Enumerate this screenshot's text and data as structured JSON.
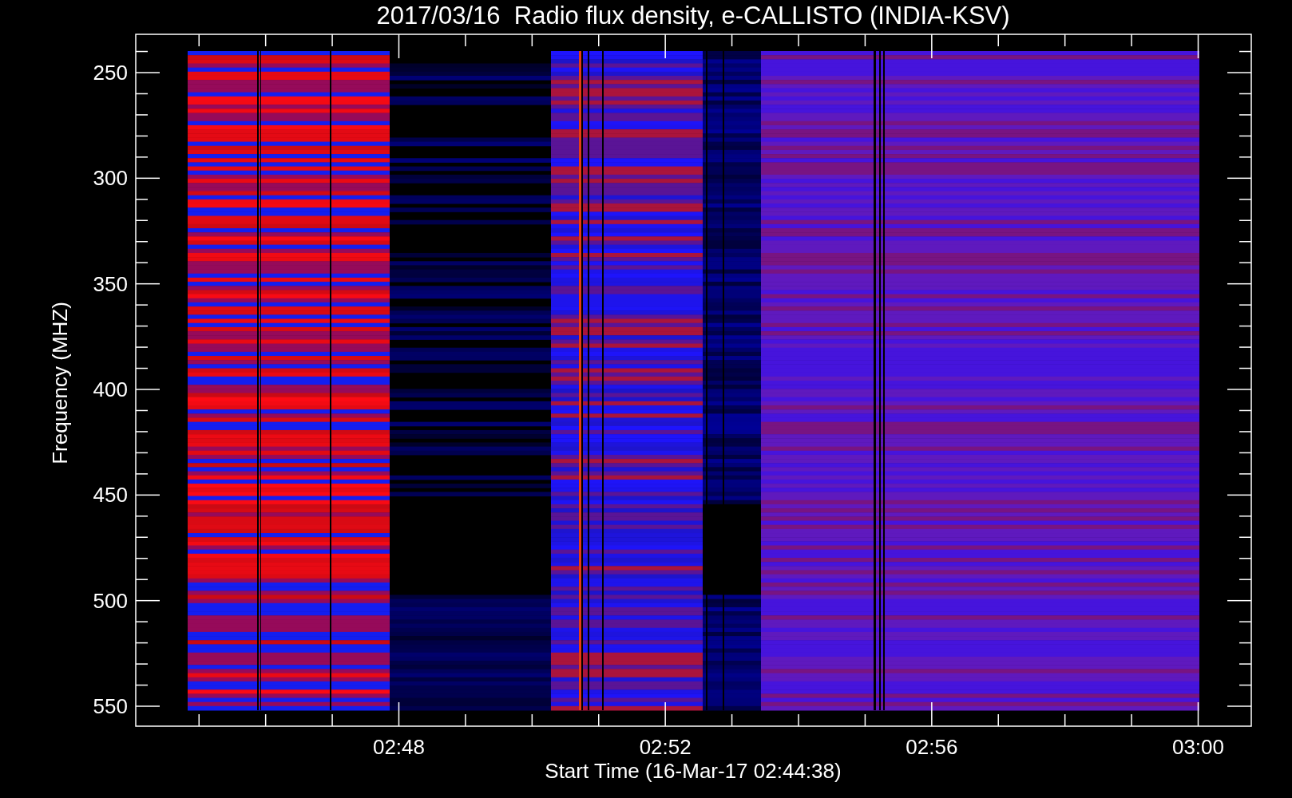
{
  "title": "2017/03/16  Radio flux density, e-CALLISTO (INDIA-KSV)",
  "y_axis": {
    "label": "Frequency (MHZ)",
    "ticks": [
      "250",
      "300",
      "350",
      "400",
      "450",
      "500",
      "550"
    ]
  },
  "x_axis": {
    "label": "Start Time (16-Mar-17 02:44:38)",
    "ticks": [
      "02:48",
      "02:52",
      "02:56",
      "03:00"
    ]
  }
}
